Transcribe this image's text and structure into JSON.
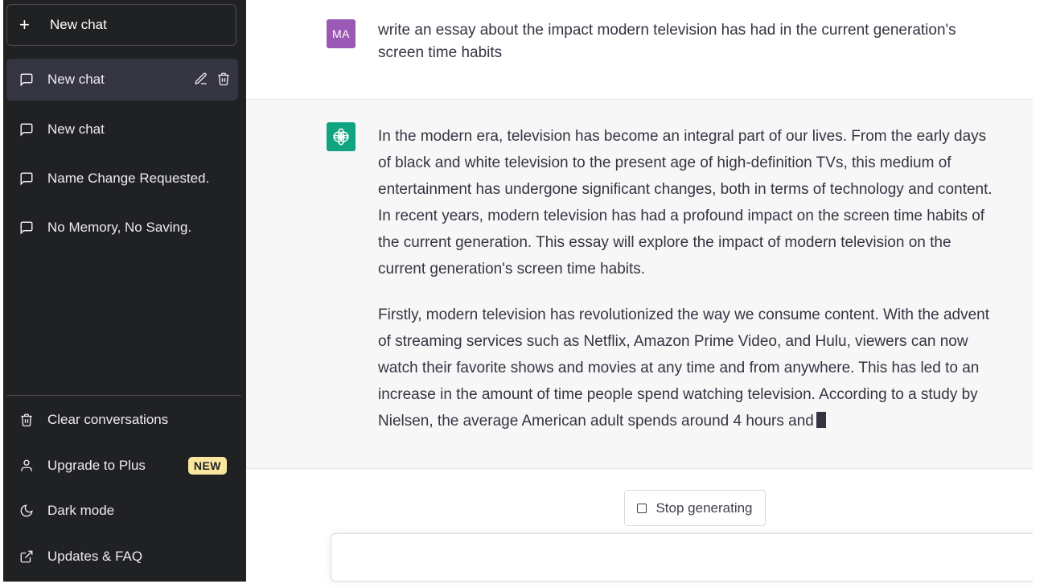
{
  "sidebar": {
    "new_chat_label": "New chat",
    "conversations": [
      {
        "label": "New chat",
        "active": true
      },
      {
        "label": "New chat",
        "active": false
      },
      {
        "label": "Name Change Requested.",
        "active": false
      },
      {
        "label": "No Memory, No Saving.",
        "active": false
      }
    ],
    "bottom_items": [
      {
        "label": "Clear conversations",
        "icon": "trash-icon"
      },
      {
        "label": "Upgrade to Plus",
        "icon": "user-icon",
        "badge": "NEW"
      },
      {
        "label": "Dark mode",
        "icon": "moon-icon"
      },
      {
        "label": "Updates & FAQ",
        "icon": "external-link-icon"
      }
    ]
  },
  "chat": {
    "user_avatar": "MA",
    "user_message": "write an essay about the impact modern television has had in the current generation's screen time habits",
    "assistant_paragraphs": [
      "In the modern era, television has become an integral part of our lives. From the early days of black and white television to the present age of high-definition TVs, this medium of entertainment has undergone significant changes, both in terms of technology and content. In recent years, modern television has had a profound impact on the screen time habits of the current generation. This essay will explore the impact of modern television on the current generation's screen time habits.",
      "Firstly, modern television has revolutionized the way we consume content. With the advent of streaming services such as Netflix, Amazon Prime Video, and Hulu, viewers can now watch their favorite shows and movies at any time and from anywhere. This has led to an increase in the amount of time people spend watching television. According to a study by Nielsen, the average American adult spends around 4 hours and"
    ],
    "stop_label": "Stop generating",
    "input_placeholder": ""
  },
  "colors": {
    "sidebar_bg": "#202123",
    "user_avatar_bg": "#9b59b6",
    "assistant_avatar_bg": "#10a37f",
    "badge_bg": "#fae69e"
  }
}
